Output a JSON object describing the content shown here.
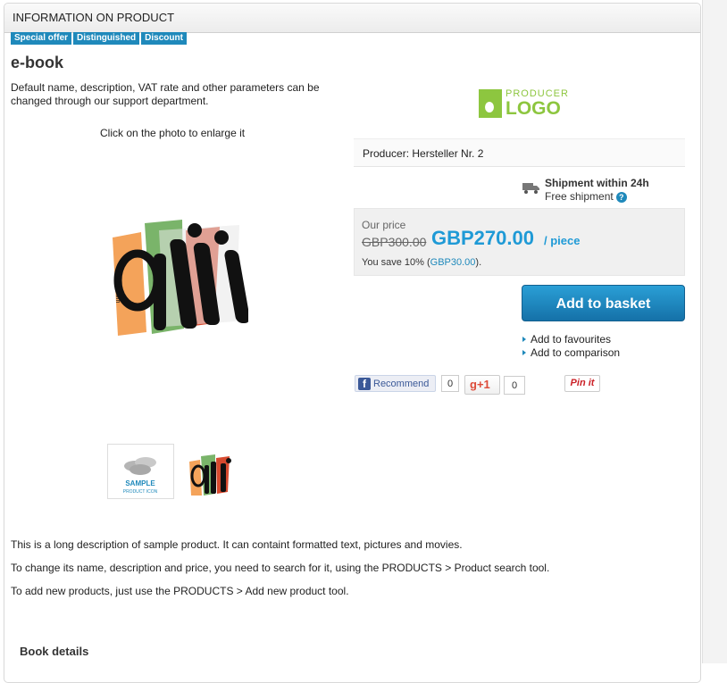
{
  "panel": {
    "header": "INFORMATION ON PRODUCT"
  },
  "badges": [
    "Special offer",
    "Distinguished",
    "Discount"
  ],
  "product": {
    "title": "e-book",
    "intro": "Default name, description, VAT rate and other parameters can be changed through our support department.",
    "photo_hint": "Click on the photo to enlarge it",
    "thumb_label_1": "SAMPLE",
    "thumb_label_2": "PRODUCT ICON",
    "photo_side_text": "IAI-SA.com"
  },
  "producer_logo": {
    "small": "PRODUCER",
    "big": "LOGO"
  },
  "producer": {
    "text": "Producer: Hersteller Nr. 2"
  },
  "shipment": {
    "title": "Shipment within 24h",
    "subtitle": "Free shipment",
    "help": "?"
  },
  "price": {
    "label": "Our price",
    "old": "GBP300.00",
    "new": "GBP270.00",
    "unit": "/ piece",
    "save_prefix": "You save 10% (",
    "save_amount": "GBP30.00",
    "save_suffix": ")."
  },
  "actions": {
    "add_to_basket": "Add to basket",
    "add_favourites": "Add to favourites",
    "add_comparison": "Add to comparison"
  },
  "social": {
    "fb_label": "Recommend",
    "fb_count": "0",
    "gplus_label": "+1",
    "gplus_count": "0",
    "pin_label": "Pin it"
  },
  "long_description": [
    "This is a long description of sample product. It can containt formatted text, pictures and movies.",
    "To change its name, description and price, you need to search for it, using the PRODUCTS > Product search tool.",
    "To add new products, just use the PRODUCTS > Add new product tool."
  ],
  "book_details": "Book details",
  "colors": {
    "accent": "#1f89bb",
    "price": "#1f9ad6",
    "producer_logo": "#8dc63f"
  },
  "icons": [
    "truck-icon",
    "help-icon",
    "facebook-icon",
    "google-plus-icon",
    "pinterest-icon",
    "bullet-arrow-icon"
  ]
}
